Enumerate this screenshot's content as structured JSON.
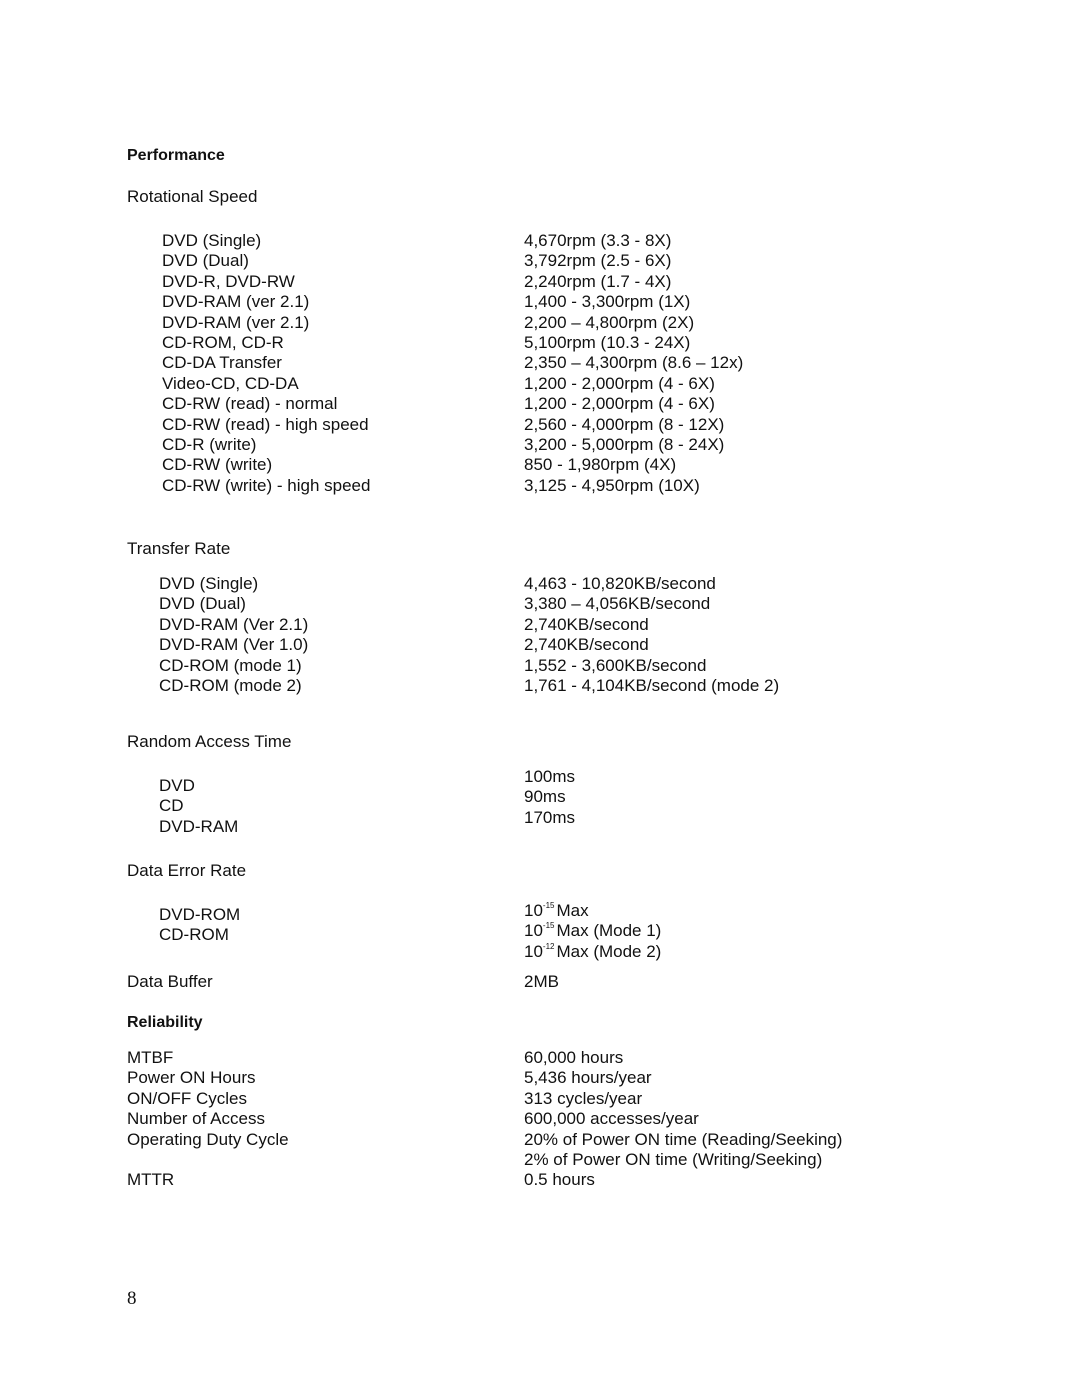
{
  "performance": {
    "heading": "Performance",
    "rotational_speed": {
      "title": "Rotational Speed",
      "rows": [
        {
          "label": "DVD (Single)",
          "value": "4,670rpm (3.3 - 8X)"
        },
        {
          "label": "DVD (Dual)",
          "value": "3,792rpm (2.5 - 6X)"
        },
        {
          "label": "DVD-R, DVD-RW",
          "value": "2,240rpm (1.7 - 4X)"
        },
        {
          "label": "DVD-RAM (ver 2.1)",
          "value": "1,400 - 3,300rpm (1X)"
        },
        {
          "label": "DVD-RAM (ver 2.1)",
          "value": "2,200 – 4,800rpm (2X)"
        },
        {
          "label": "CD-ROM, CD-R",
          "value": "5,100rpm (10.3 - 24X)"
        },
        {
          "label": "CD-DA Transfer",
          "value": "2,350 – 4,300rpm (8.6 – 12x)"
        },
        {
          "label": "Video-CD, CD-DA",
          "value": "1,200 - 2,000rpm (4 - 6X)"
        },
        {
          "label": "CD-RW (read) - normal",
          "value": "1,200 - 2,000rpm (4 - 6X)"
        },
        {
          "label": "CD-RW (read) - high speed",
          "value": "2,560 - 4,000rpm (8 - 12X)"
        },
        {
          "label": "CD-R (write)",
          "value": "3,200 - 5,000rpm (8 - 24X)"
        },
        {
          "label": "CD-RW (write)",
          "value": "850 - 1,980rpm (4X)"
        },
        {
          "label": "CD-RW (write) - high speed",
          "value": "3,125 - 4,950rpm (10X)"
        }
      ]
    },
    "transfer_rate": {
      "title": "Transfer Rate",
      "rows": [
        {
          "label": "DVD (Single)",
          "value": "4,463 - 10,820KB/second"
        },
        {
          "label": "DVD (Dual)",
          "value": "3,380 – 4,056KB/second"
        },
        {
          "label": "DVD-RAM (Ver 2.1)",
          "value": "2,740KB/second"
        },
        {
          "label": "DVD-RAM (Ver 1.0)",
          "value": "2,740KB/second"
        },
        {
          "label": "CD-ROM (mode 1)",
          "value": "1,552 - 3,600KB/second"
        },
        {
          "label": "CD-ROM (mode 2)",
          "value": "1,761 - 4,104KB/second (mode 2)"
        }
      ]
    },
    "random_access_time": {
      "title": "Random Access Time",
      "labels": [
        "DVD",
        "CD",
        "DVD-RAM"
      ],
      "values": [
        "100ms",
        "90ms",
        "170ms"
      ]
    },
    "data_error_rate": {
      "title": "Data Error Rate",
      "labels": [
        "DVD-ROM",
        "CD-ROM"
      ],
      "values": [
        {
          "base": "10",
          "exp": "-15",
          "text": "Max"
        },
        {
          "base": "10",
          "exp": "-15",
          "text": "Max (Mode 1)"
        },
        {
          "base": "10",
          "exp": "-12",
          "text": "Max (Mode 2)"
        }
      ]
    },
    "data_buffer": {
      "label": "Data Buffer",
      "value": "2MB"
    }
  },
  "reliability": {
    "heading": "Reliability",
    "rows": [
      {
        "label": "MTBF",
        "value": "60,000 hours"
      },
      {
        "label": "Power ON Hours",
        "value": "5,436 hours/year"
      },
      {
        "label": "ON/OFF Cycles",
        "value": "313 cycles/year"
      },
      {
        "label": "Number of Access",
        "value": "600,000 accesses/year"
      },
      {
        "label": "Operating Duty Cycle",
        "value": "20% of Power ON time (Reading/Seeking)"
      },
      {
        "label": "",
        "value": "2% of Power ON time (Writing/Seeking)"
      },
      {
        "label": "MTTR",
        "value": "0.5 hours"
      }
    ]
  },
  "page_number": "8"
}
